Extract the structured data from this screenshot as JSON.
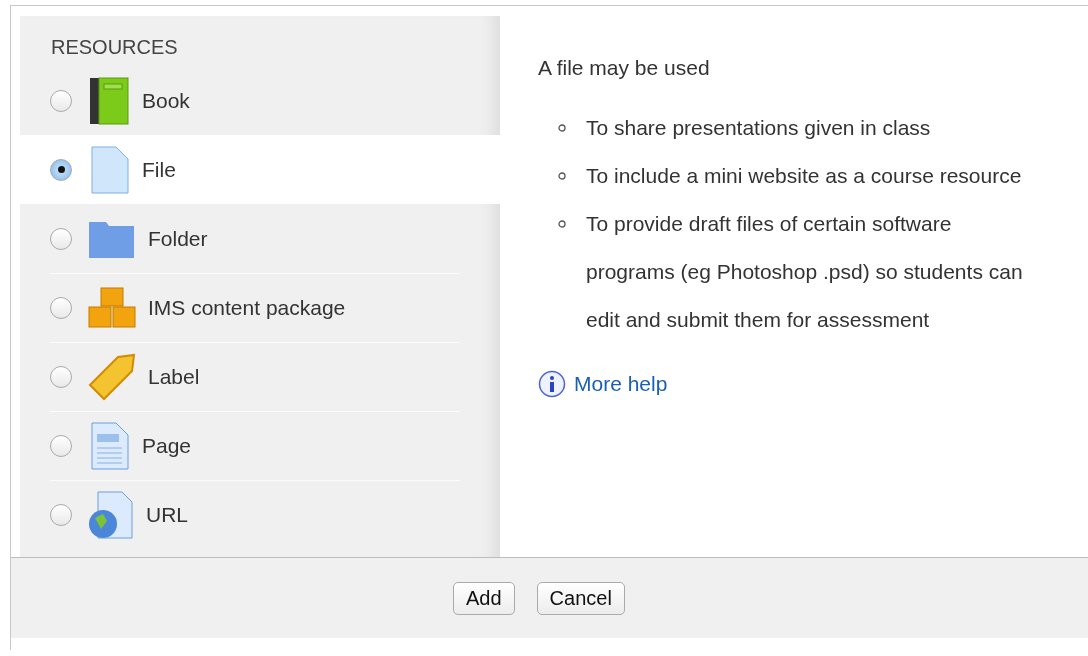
{
  "chooser": {
    "heading": "RESOURCES",
    "items": [
      {
        "kind": "book",
        "label": "Book",
        "selected": false
      },
      {
        "kind": "file",
        "label": "File",
        "selected": true
      },
      {
        "kind": "folder",
        "label": "Folder",
        "selected": false
      },
      {
        "kind": "package",
        "label": "IMS content package",
        "selected": false
      },
      {
        "kind": "label",
        "label": "Label",
        "selected": false
      },
      {
        "kind": "page",
        "label": "Page",
        "selected": false
      },
      {
        "kind": "url",
        "label": "URL",
        "selected": false
      }
    ]
  },
  "help": {
    "intro": "A file may be used",
    "bullets": [
      "To share presentations given in class",
      "To include a mini website as a course resource",
      "To provide draft files of certain software programs (eg Photoshop .psd) so students can edit and submit them for assessment"
    ],
    "more_help": "More help"
  },
  "buttons": [
    "Add",
    "Cancel"
  ]
}
